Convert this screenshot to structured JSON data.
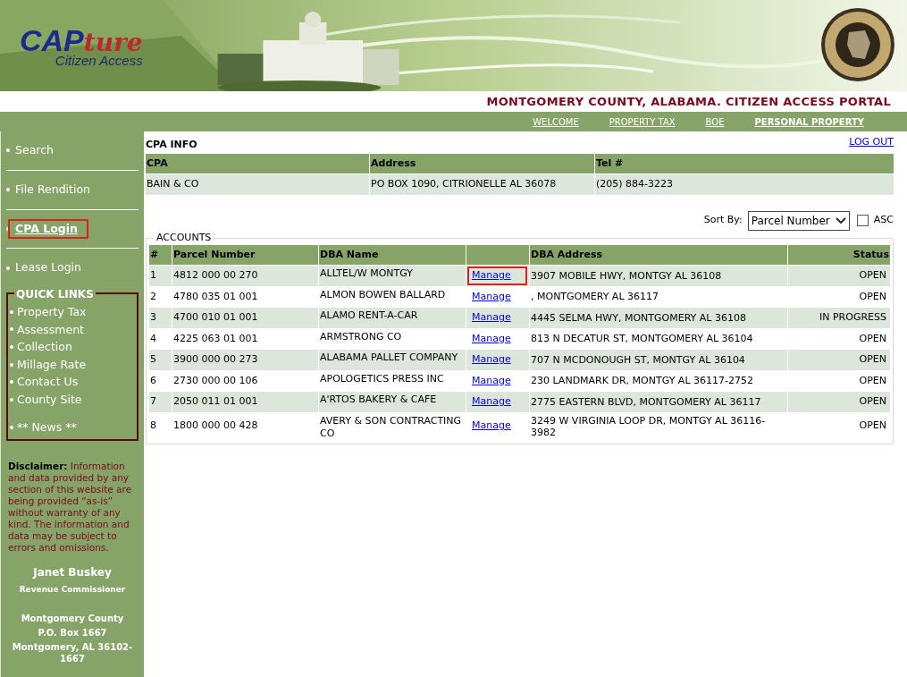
{
  "header": {
    "logo": {
      "main": "CAP",
      "accent": "ture",
      "subtitle": "Citizen Access"
    },
    "portal_title": "MONTGOMERY COUNTY, ALABAMA. CITIZEN ACCESS PORTAL"
  },
  "top_nav": [
    {
      "label": "WELCOME",
      "selected": false
    },
    {
      "label": "PROPERTY TAX",
      "selected": false
    },
    {
      "label": "BOE",
      "selected": false
    },
    {
      "label": "PERSONAL PROPERTY",
      "selected": true
    }
  ],
  "sidebar": {
    "items": [
      {
        "label": "Search",
        "selected": false,
        "highlighted": false
      },
      {
        "label": "File Rendition",
        "selected": false,
        "highlighted": false
      },
      {
        "label": "CPA Login",
        "selected": true,
        "highlighted": true
      },
      {
        "label": "Lease Login",
        "selected": false,
        "highlighted": false
      }
    ],
    "quick_links": {
      "title": "QUICK LINKS",
      "items": [
        "Property Tax",
        "Assessment",
        "Collection",
        "Millage Rate",
        "Contact Us",
        "County Site"
      ],
      "news": "** News **"
    },
    "disclaimer": {
      "label": "Disclaimer:",
      "text": "Information and data provided by any section of this website are being provided “as-is” without warranty of any kind. The information and data may be subject to errors and omissions."
    },
    "commissioner": {
      "name": "Janet Buskey",
      "title": "Revenue Commissioner"
    },
    "address": [
      "Montgomery County",
      "P.O. Box 1667",
      "Montgomery, AL 36102-1667"
    ]
  },
  "cpa_info": {
    "title": "CPA INFO",
    "logout": "LOG OUT",
    "columns": [
      "CPA",
      "Address",
      "Tel #"
    ],
    "row": [
      "BAIN & CO",
      "PO BOX 1090, CITRIONELLE AL 36078",
      "(205) 884-3223"
    ]
  },
  "sort": {
    "label": "Sort By:",
    "value": "Parcel Number",
    "asc_label": "ASC",
    "asc_checked": false
  },
  "accounts": {
    "title": "ACCOUNTS",
    "columns": [
      "#",
      "Parcel Number",
      "DBA Name",
      "DBA Address",
      "Status"
    ],
    "rows": [
      {
        "number": "1",
        "parcel": "4812 000 00 270",
        "dba_name": "ALLTEL/W MONTGY",
        "action": "Manage",
        "address": "3907 MOBILE HWY,  MONTGY  AL 36108",
        "status": "OPEN",
        "highlighted": true
      },
      {
        "number": "2",
        "parcel": "4780 035 01 001",
        "dba_name": "ALMON BOWEN BALLARD",
        "action": "Manage",
        "address": ",  MONTGOMERY  AL 36117",
        "status": "OPEN",
        "highlighted": false
      },
      {
        "number": "3",
        "parcel": "4700 010 01 001",
        "dba_name": "ALAMO RENT-A-CAR",
        "action": "Manage",
        "address": "4445 SELMA HWY,  MONTGOMERY  AL 36108",
        "status": "IN PROGRESS",
        "highlighted": false
      },
      {
        "number": "4",
        "parcel": "4225 063 01 001",
        "dba_name": "ARMSTRONG CO",
        "action": "Manage",
        "address": "813 N DECATUR ST,  MONTGOMERY  AL 36104",
        "status": "OPEN",
        "highlighted": false
      },
      {
        "number": "5",
        "parcel": "3900 000 00 273",
        "dba_name": "ALABAMA PALLET COMPANY",
        "action": "Manage",
        "address": "707 N MCDONOUGH ST,  MONTGY  AL 36104",
        "status": "OPEN",
        "highlighted": false
      },
      {
        "number": "6",
        "parcel": "2730 000 00 106",
        "dba_name": "APOLOGETICS PRESS INC",
        "action": "Manage",
        "address": "230 LANDMARK DR,  MONTGY  AL 36117-2752",
        "status": "OPEN",
        "highlighted": false
      },
      {
        "number": "7",
        "parcel": "2050 011 01 001",
        "dba_name": "A'RTOS BAKERY & CAFE",
        "action": "Manage",
        "address": "2775 EASTERN BLVD,  MONTGOMERY  AL 36117",
        "status": "OPEN",
        "highlighted": false
      },
      {
        "number": "8",
        "parcel": "1800 000 00 428",
        "dba_name": "AVERY & SON CONTRACTING CO",
        "action": "Manage",
        "address": "3249 W VIRGINIA LOOP DR,  MONTGY  AL 36116-3982",
        "status": "OPEN",
        "highlighted": false
      }
    ]
  }
}
